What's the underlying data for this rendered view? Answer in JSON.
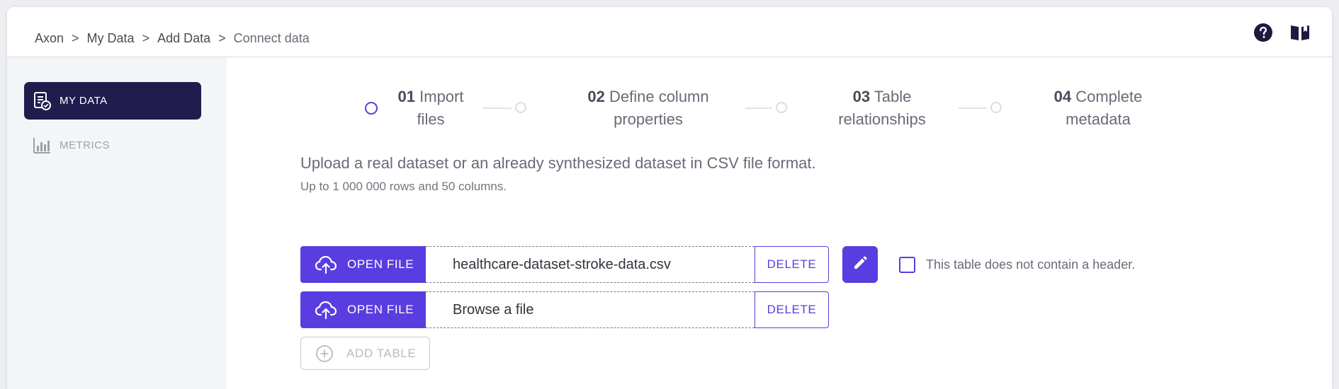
{
  "breadcrumb": {
    "items": [
      "Axon",
      "My Data",
      "Add Data",
      "Connect data"
    ],
    "separator": ">"
  },
  "header": {
    "icons": [
      "help-icon",
      "book-icon"
    ]
  },
  "sidebar": {
    "items": [
      {
        "label": "MY DATA",
        "icon": "data-sheet-icon",
        "active": true
      },
      {
        "label": "METRICS",
        "icon": "bar-chart-icon",
        "active": false
      }
    ]
  },
  "stepper": {
    "steps": [
      {
        "num": "01",
        "line1": "Import",
        "line2": "files",
        "active": true
      },
      {
        "num": "02",
        "line1": "Define column",
        "line2": "properties",
        "active": false
      },
      {
        "num": "03",
        "line1": "Table",
        "line2": "relationships",
        "active": false
      },
      {
        "num": "04",
        "line1": "Complete",
        "line2": "metadata",
        "active": false
      }
    ]
  },
  "main": {
    "description": "Upload a real dataset or an already synthesized dataset in CSV file format.",
    "subdescription": "Up to 1 000 000 rows and 50 columns.",
    "files": [
      {
        "open_label": "OPEN FILE",
        "filename": "healthcare-dataset-stroke-data.csv",
        "delete_label": "DELETE"
      },
      {
        "open_label": "OPEN FILE",
        "filename": "Browse a file",
        "delete_label": "DELETE"
      }
    ],
    "no_header_label": "This table does not contain a header.",
    "add_table_label": "ADD TABLE"
  },
  "colors": {
    "accent": "#5a3de0",
    "sidebar_active": "#201c4e"
  }
}
